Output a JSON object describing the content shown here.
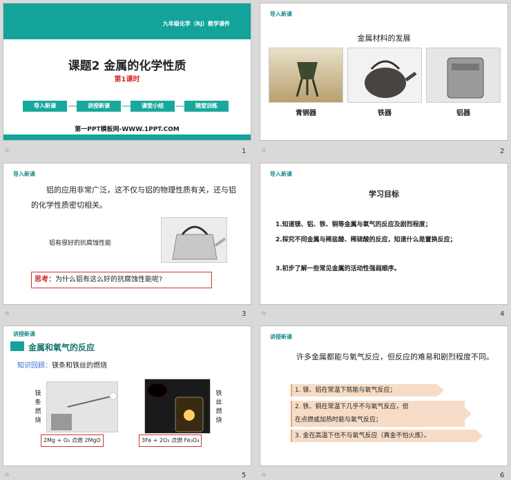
{
  "slides": [
    {
      "id": 1,
      "course": "九年级化学（RJ）教学课件",
      "title": "课题2  金属的化学性质",
      "subtitle": "第1课时",
      "nav": [
        "导入新课",
        "讲授新课",
        "课堂小结",
        "随堂训练"
      ],
      "footer": "第一PPT模板网-WWW.1PPT.COM",
      "number": "1"
    },
    {
      "id": 2,
      "tag": "导入新课",
      "heading": "金属材料的发展",
      "captions": [
        "青铜器",
        "铁器",
        "铝器"
      ],
      "number": "2"
    },
    {
      "id": 3,
      "tag": "导入新课",
      "paragraph": "铝的应用非常广泛，这不仅与铝的物理性质有关，还与铝的化学性质密切相关。",
      "kettle_label": "铝有很好的抗腐蚀性能",
      "think_label": "思考：",
      "think_text": "为什么铝有这么好的抗腐蚀性能呢?",
      "number": "3"
    },
    {
      "id": 4,
      "tag": "导入新课",
      "heading": "学习目标",
      "goals": [
        "1.知道镁、铝、铁、铜等金属与氧气的反应及剧烈程度；",
        "2.探究不同金属与稀盐酸、稀硫酸的反应，知道什么是置换反应；",
        "3.初步了解一些常见金属的活动性强弱顺序。"
      ],
      "number": "4"
    },
    {
      "id": 5,
      "tag": "讲授新课",
      "heading": "金属和氧气的反应",
      "review_label": "知识回顾：",
      "review_text": "镁条和铁丝的燃烧",
      "mg_label": "镁条燃烧",
      "fe_label": "铁丝燃烧",
      "eq1": "2Mg + O₂ 点燃 2MgO",
      "eq2": "3Fe + 2O₂ 点燃 Fe₃O₄",
      "number": "5"
    },
    {
      "id": 6,
      "tag": "讲授新课",
      "paragraph": "许多金属都能与氧气反应，但反应的难易和剧烈程度不同。",
      "items": [
        "1. 镁、铝在常温下就能与氧气反应；",
        "2. 铁、铜在常温下几乎不与氧气反应，但",
        "在点燃或加热时能与氧气反应；",
        "3. 金在高温下也不与氧气反应（真金不怕火炼）。"
      ],
      "number": "6"
    }
  ],
  "colors": {
    "teal": "#14a39a",
    "red": "#d42a2a",
    "border_red": "#cc3333"
  }
}
